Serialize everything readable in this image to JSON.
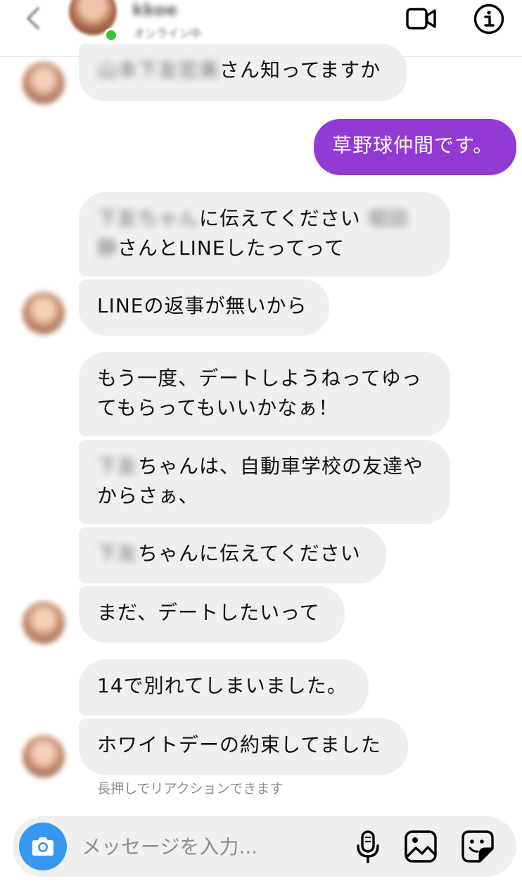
{
  "header": {
    "contact_name": "kkoe",
    "contact_status": "オンライン中",
    "icons": [
      "chevron-left-icon",
      "video-camera-icon",
      "info-icon"
    ]
  },
  "messages": [
    {
      "side": "in",
      "blurred_prefix": "山本下友宏美",
      "text": "さん知ってますか"
    },
    {
      "side": "out",
      "text": "草野球仲間です。"
    },
    {
      "side": "in",
      "lines": [
        {
          "blurred": "下友ちゃん",
          "text": "に伝えてください",
          "blurred_suffix": "堀田"
        },
        {
          "blurred": "静",
          "text": "さんとLINEしたってって"
        }
      ]
    },
    {
      "side": "in",
      "text": "LINEの返事が無いから"
    },
    {
      "side": "in",
      "lines": [
        {
          "text": "もう一度、デートしようねってゆっ"
        },
        {
          "text": "てもらってもいいかなぁ！"
        }
      ]
    },
    {
      "side": "in",
      "lines": [
        {
          "blurred": "下友",
          "text": "ちゃんは、自動車学校の友達や"
        },
        {
          "text": "からさぁ、"
        }
      ]
    },
    {
      "side": "in",
      "blurred_prefix": "下友",
      "text": "ちゃんに伝えてください"
    },
    {
      "side": "in",
      "text": "まだ、デートしたいって"
    },
    {
      "side": "in",
      "text": "14で別れてしまいました。"
    },
    {
      "side": "in",
      "text": "ホワイトデーの約束してました"
    }
  ],
  "hint": "長押しでリアクションできます",
  "composer": {
    "placeholder": "メッセージを入力...",
    "icons": [
      "camera-icon",
      "microphone-icon",
      "gallery-icon",
      "sticker-icon"
    ]
  },
  "colors": {
    "outgoing_bubble": "#9339d4",
    "incoming_bubble": "#efefef",
    "camera_button": "#3797f0",
    "online_dot": "#37c43b"
  }
}
